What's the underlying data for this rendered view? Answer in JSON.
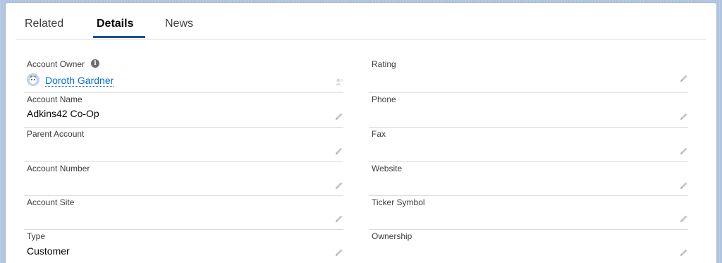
{
  "tabs": [
    {
      "label": "Related",
      "active": false
    },
    {
      "label": "Details",
      "active": true
    },
    {
      "label": "News",
      "active": false
    }
  ],
  "left_fields": {
    "owner": {
      "label": "Account Owner",
      "value": "Doroth Gardner"
    },
    "account_name": {
      "label": "Account Name",
      "value": "Adkins42 Co-Op"
    },
    "parent_account": {
      "label": "Parent Account",
      "value": ""
    },
    "account_number": {
      "label": "Account Number",
      "value": ""
    },
    "account_site": {
      "label": "Account Site",
      "value": ""
    },
    "type": {
      "label": "Type",
      "value": "Customer"
    }
  },
  "right_fields": {
    "rating": {
      "label": "Rating",
      "value": ""
    },
    "phone": {
      "label": "Phone",
      "value": ""
    },
    "fax": {
      "label": "Fax",
      "value": ""
    },
    "website": {
      "label": "Website",
      "value": ""
    },
    "ticker_symbol": {
      "label": "Ticker Symbol",
      "value": ""
    },
    "ownership": {
      "label": "Ownership",
      "value": ""
    }
  },
  "colors": {
    "accent": "#1b5297",
    "link": "#0070d2",
    "border": "#dddbda"
  }
}
